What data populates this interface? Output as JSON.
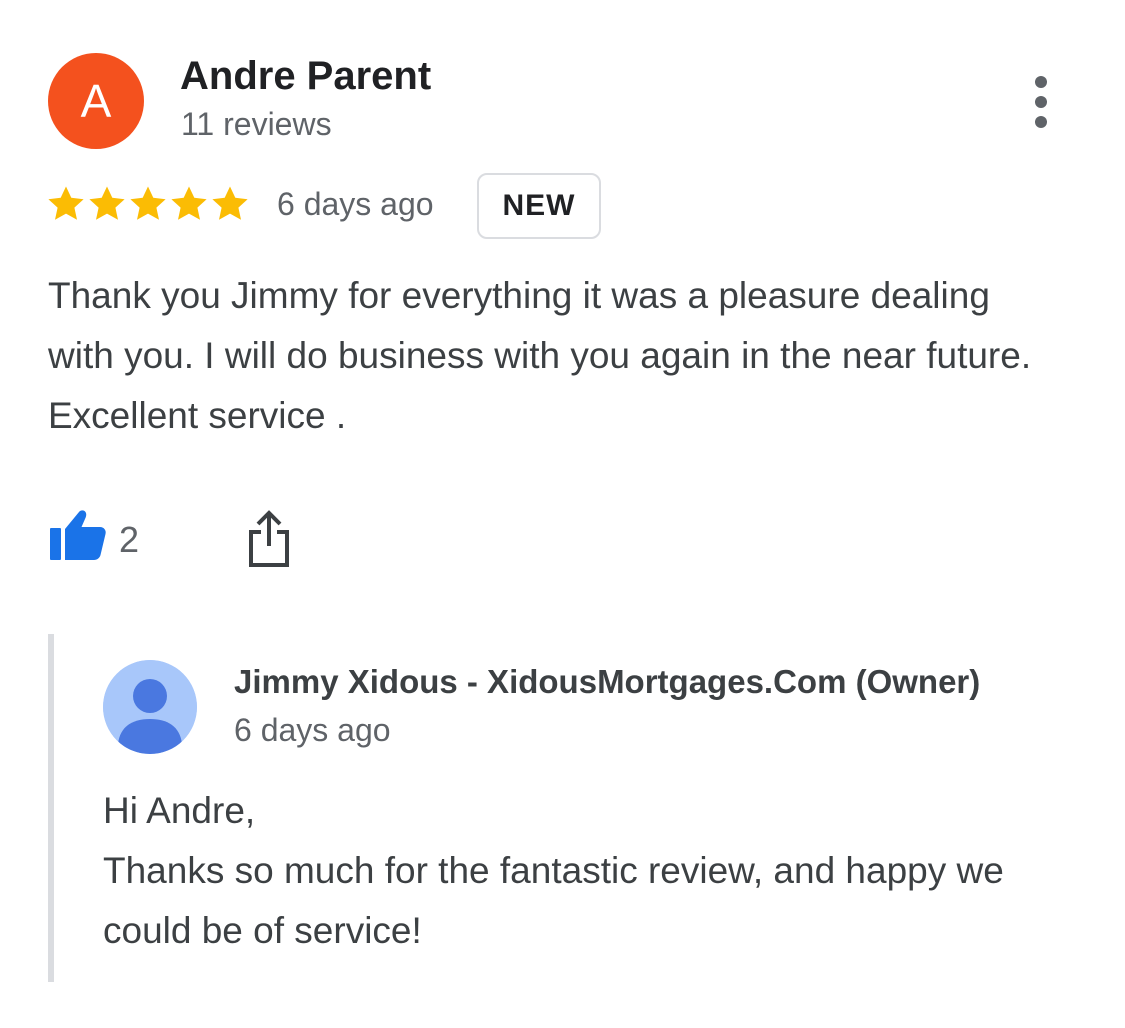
{
  "review": {
    "avatar_initial": "A",
    "reviewer_name": "Andre Parent",
    "reviewer_reviews": "11 reviews",
    "rating": 5,
    "rating_max": 5,
    "date": "6 days ago",
    "badge": "NEW",
    "text": "Thank you Jimmy for everything it was a pleasure dealing with you. I will do business with you again in the near future. Excellent service .",
    "like_count": "2",
    "icons": {
      "more": "more-vert-icon",
      "like": "thumbs-up-icon",
      "share": "share-icon",
      "star": "star-icon"
    }
  },
  "owner_reply": {
    "owner_name": "Jimmy Xidous - XidousMortgages.Com (Owner)",
    "date": "6 days ago",
    "greeting": "Hi Andre,",
    "message": "Thanks so much for the fantastic review, and happy we could be of service!",
    "avatar_icon": "person-avatar-icon"
  },
  "colors": {
    "avatar_reviewer": "#f4511e",
    "star": "#fbbc04",
    "like": "#1a73e8",
    "owner_avatar_bg": "#a8c7fa",
    "owner_avatar_figure": "#4a78e0"
  }
}
